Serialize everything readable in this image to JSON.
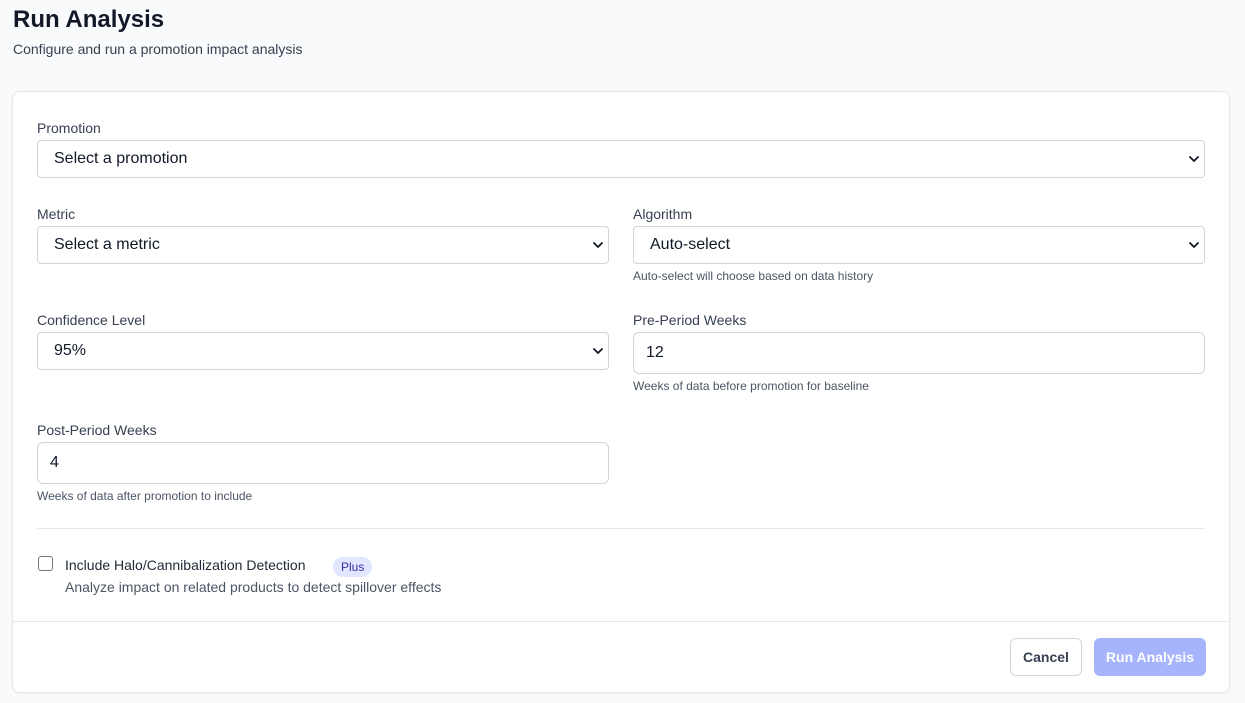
{
  "header": {
    "title": "Run Analysis",
    "subtitle": "Configure and run a promotion impact analysis"
  },
  "form": {
    "promotion": {
      "label": "Promotion",
      "value": "Select a promotion"
    },
    "metric": {
      "label": "Metric",
      "value": "Select a metric"
    },
    "algorithm": {
      "label": "Algorithm",
      "value": "Auto-select",
      "help": "Auto-select will choose based on data history"
    },
    "confidence": {
      "label": "Confidence Level",
      "value": "95%"
    },
    "pre_period": {
      "label": "Pre-Period Weeks",
      "value": "12",
      "help": "Weeks of data before promotion for baseline"
    },
    "post_period": {
      "label": "Post-Period Weeks",
      "value": "4",
      "help": "Weeks of data after promotion to include"
    },
    "halo": {
      "label": "Include Halo/Cannibalization Detection",
      "badge": "Plus",
      "description": "Analyze impact on related products to detect spillover effects",
      "checked": false
    }
  },
  "actions": {
    "cancel_label": "Cancel",
    "run_label": "Run Analysis"
  },
  "colors": {
    "accent_disabled": "#a5b4fc",
    "badge_bg": "#e0e7ff",
    "badge_text": "#3730a3"
  },
  "icons": {
    "select_arrow": "chevron-down-icon"
  }
}
